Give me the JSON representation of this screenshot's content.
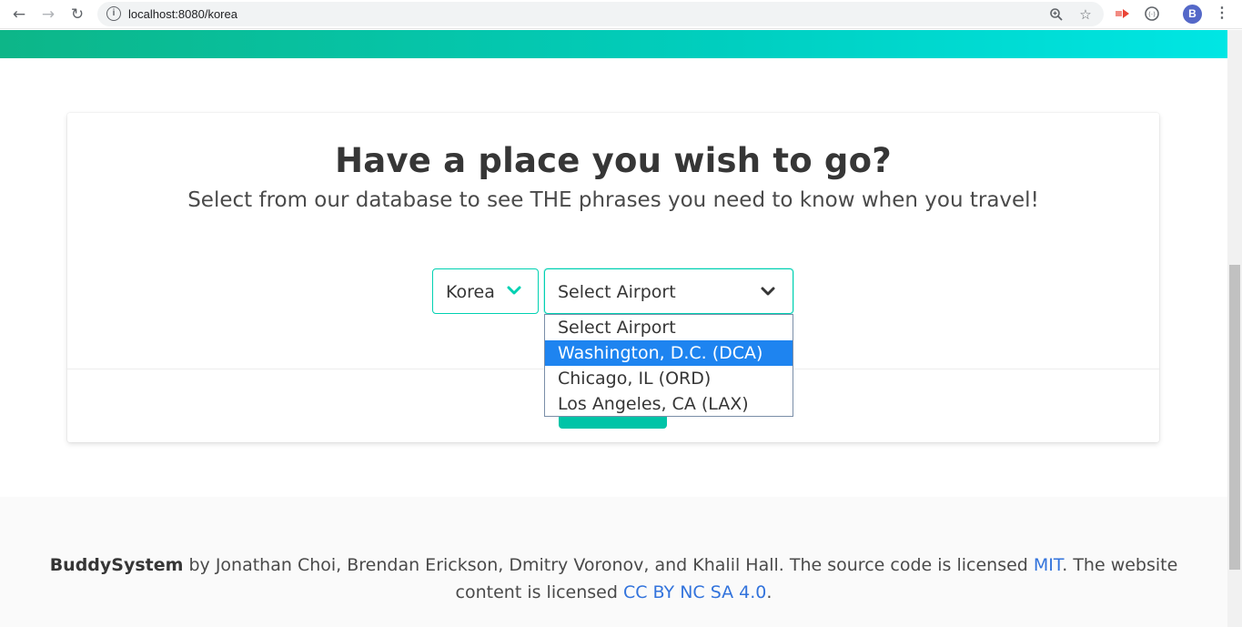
{
  "browser": {
    "url": "localhost:8080/korea",
    "icons": {
      "back": "back-arrow-icon",
      "forward": "forward-arrow-icon",
      "reload": "reload-icon",
      "info": "site-info-icon",
      "zoom": "zoom-icon",
      "bookmark": "star-icon",
      "extension1": "cast-extension-icon",
      "extension2": "extension-icon",
      "menu": "kebab-menu-icon"
    },
    "profile_initial": "B"
  },
  "colors": {
    "accent": "#00d1b2",
    "gradient_start": "#0db688",
    "gradient_end": "#00e6e4",
    "link": "#3273dc",
    "option_highlight": "#1e84f0"
  },
  "card": {
    "title": "Have a place you wish to go?",
    "subtitle": "Select from our database to see THE phrases you need to know when you travel!",
    "country_select": {
      "value": "Korea",
      "icon": "chevron-down-icon"
    },
    "airport_select": {
      "value": "Select Airport",
      "icon": "chevron-down-icon",
      "options": [
        {
          "label": "Select Airport",
          "selected": false
        },
        {
          "label": "Washington, D.C. (DCA)",
          "selected": true
        },
        {
          "label": "Chicago, IL (ORD)",
          "selected": false
        },
        {
          "label": "Los Angeles, CA (LAX)",
          "selected": false
        }
      ]
    }
  },
  "footer": {
    "brand": "BuddySystem",
    "text_by": " by Jonathan Choi, Brendan Erickson, Dmitry Voronov, and Khalil Hall. The source code is licensed ",
    "mit_link": "MIT",
    "text_content": ". The website content is licensed ",
    "cc_link": "CC BY NC SA 4.0",
    "text_end": "."
  }
}
